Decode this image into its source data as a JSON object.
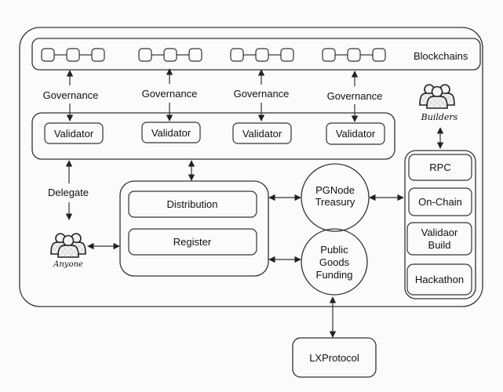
{
  "diagram": {
    "blockchains_label": "Blockchains",
    "governance_labels": [
      "Governance",
      "Governance",
      "Governance",
      "Governance"
    ],
    "validators": [
      "Validator",
      "Validator",
      "Validator",
      "Validator"
    ],
    "delegate_label": "Delegate",
    "anyone_label": "Anyone",
    "builders_label": "Builders",
    "core_modules": [
      "Distribution",
      "Register"
    ],
    "treasury": {
      "line1": "PGNode",
      "line2": "Treasury"
    },
    "public_goods": {
      "line1": "Public",
      "line2": "Goods",
      "line3": "Funding"
    },
    "builder_services": [
      {
        "line1": "RPC",
        "line2": ""
      },
      {
        "line1": "On-Chain",
        "line2": ""
      },
      {
        "line1": "Validaor",
        "line2": "Build"
      },
      {
        "line1": "Hackathon",
        "line2": ""
      }
    ],
    "protocol_label": "LXProtocol",
    "colors": {
      "stroke": "#333333",
      "background": "#fbfbfb",
      "text": "#111111"
    }
  }
}
